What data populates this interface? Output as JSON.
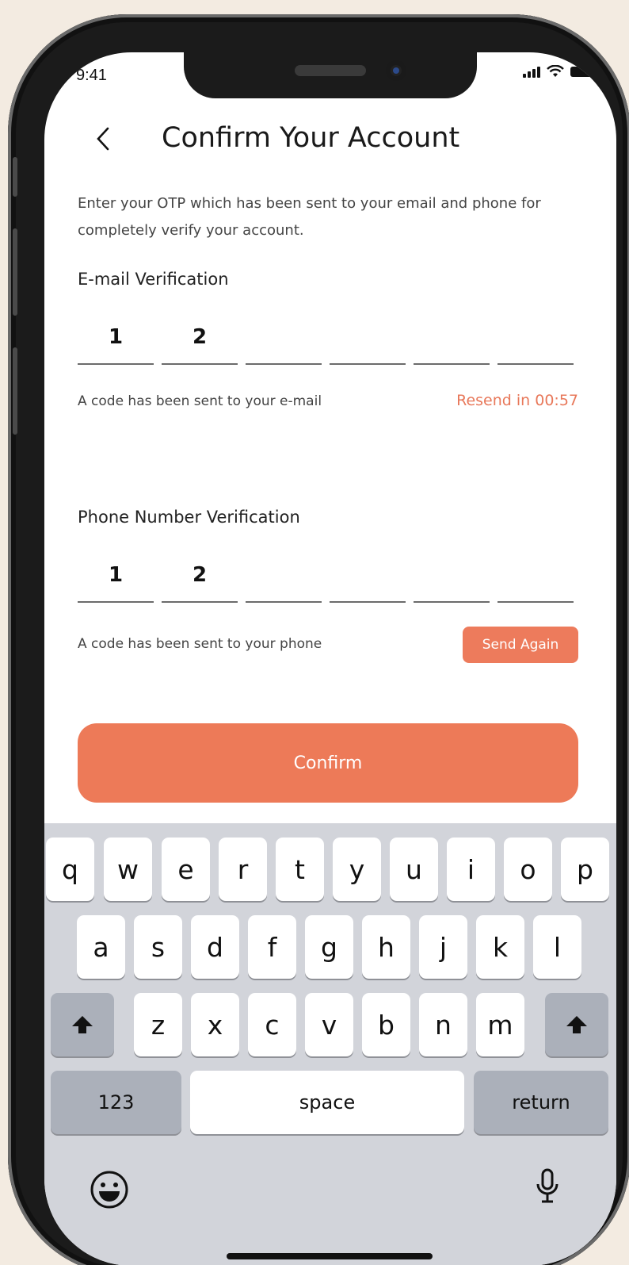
{
  "status_bar": {
    "time": "9:41"
  },
  "header": {
    "title": "Confirm Your Account"
  },
  "intro_text": "Enter your OTP which has been sent to your email and phone for completely verify your account.",
  "email_section": {
    "label": "E-mail Verification",
    "digits": [
      "1",
      "2",
      "",
      "",
      "",
      ""
    ],
    "helper": "A code has been sent to your e-mail",
    "resend": "Resend in 00:57"
  },
  "phone_section": {
    "label": "Phone Number Verification",
    "digits": [
      "1",
      "2",
      "",
      "",
      "",
      ""
    ],
    "helper": "A code has been sent to your phone",
    "send_again": "Send Again"
  },
  "confirm_label": "Confirm",
  "keyboard": {
    "row1": [
      "q",
      "w",
      "e",
      "r",
      "t",
      "y",
      "u",
      "i",
      "o",
      "p"
    ],
    "row2": [
      "a",
      "s",
      "d",
      "f",
      "g",
      "h",
      "j",
      "k",
      "l"
    ],
    "row3": [
      "z",
      "x",
      "c",
      "v",
      "b",
      "n",
      "m"
    ],
    "numbers_key": "123",
    "space_key": "space",
    "return_key": "return"
  },
  "colors": {
    "accent": "#ED7A58",
    "resend_text": "#E8785A",
    "keyboard_bg": "#D2D4DA"
  }
}
